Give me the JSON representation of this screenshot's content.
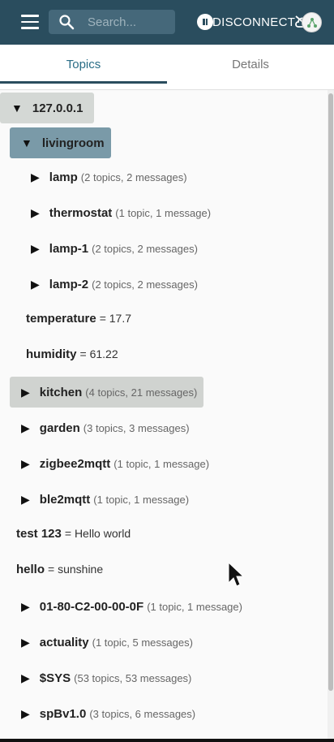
{
  "appbar": {
    "search_placeholder": "Search...",
    "disconnect_label": "DISCONNECT",
    "icons": [
      "menu-icon",
      "search-icon",
      "pause-icon",
      "cloud-off-icon",
      "avatar-icon"
    ]
  },
  "tabs": [
    {
      "label": "Topics",
      "active": true
    },
    {
      "label": "Details",
      "active": false
    }
  ],
  "tree": {
    "root": {
      "name": "127.0.0.1"
    },
    "livingroom": {
      "name": "livingroom"
    },
    "lamp": {
      "name": "lamp",
      "meta": "(2 topics, 2 messages)"
    },
    "thermostat": {
      "name": "thermostat",
      "meta": "(1 topic, 1 message)"
    },
    "lamp1": {
      "name": "lamp-1",
      "meta": "(2 topics, 2 messages)"
    },
    "lamp2": {
      "name": "lamp-2",
      "meta": "(2 topics, 2 messages)"
    },
    "temperature": {
      "name": "temperature",
      "value": "= 17.7"
    },
    "humidity": {
      "name": "humidity",
      "value": "= 61.22"
    },
    "kitchen": {
      "name": "kitchen",
      "meta": "(4 topics, 21 messages)"
    },
    "garden": {
      "name": "garden",
      "meta": "(3 topics, 3 messages)"
    },
    "zigbee2mqtt": {
      "name": "zigbee2mqtt",
      "meta": "(1 topic, 1 message)"
    },
    "ble2mqtt": {
      "name": "ble2mqtt",
      "meta": "(1 topic, 1 message)"
    },
    "test123": {
      "name": "test 123",
      "value": "= Hello world"
    },
    "hello": {
      "name": "hello",
      "value": "= sunshine"
    },
    "mac": {
      "name": "01-80-C2-00-00-0F",
      "meta": "(1 topic, 1 message)"
    },
    "actuality": {
      "name": "actuality",
      "meta": "(1 topic, 5 messages)"
    },
    "sys": {
      "name": "$SYS",
      "meta": "(53 topics, 53 messages)"
    },
    "spbv": {
      "name": "spBv1.0",
      "meta": "(3 topics, 6 messages)"
    }
  },
  "colors": {
    "appbar": "#2a4d5e",
    "selected_blue": "#7a9aa8",
    "selected_grey": "#d4d8d5"
  }
}
